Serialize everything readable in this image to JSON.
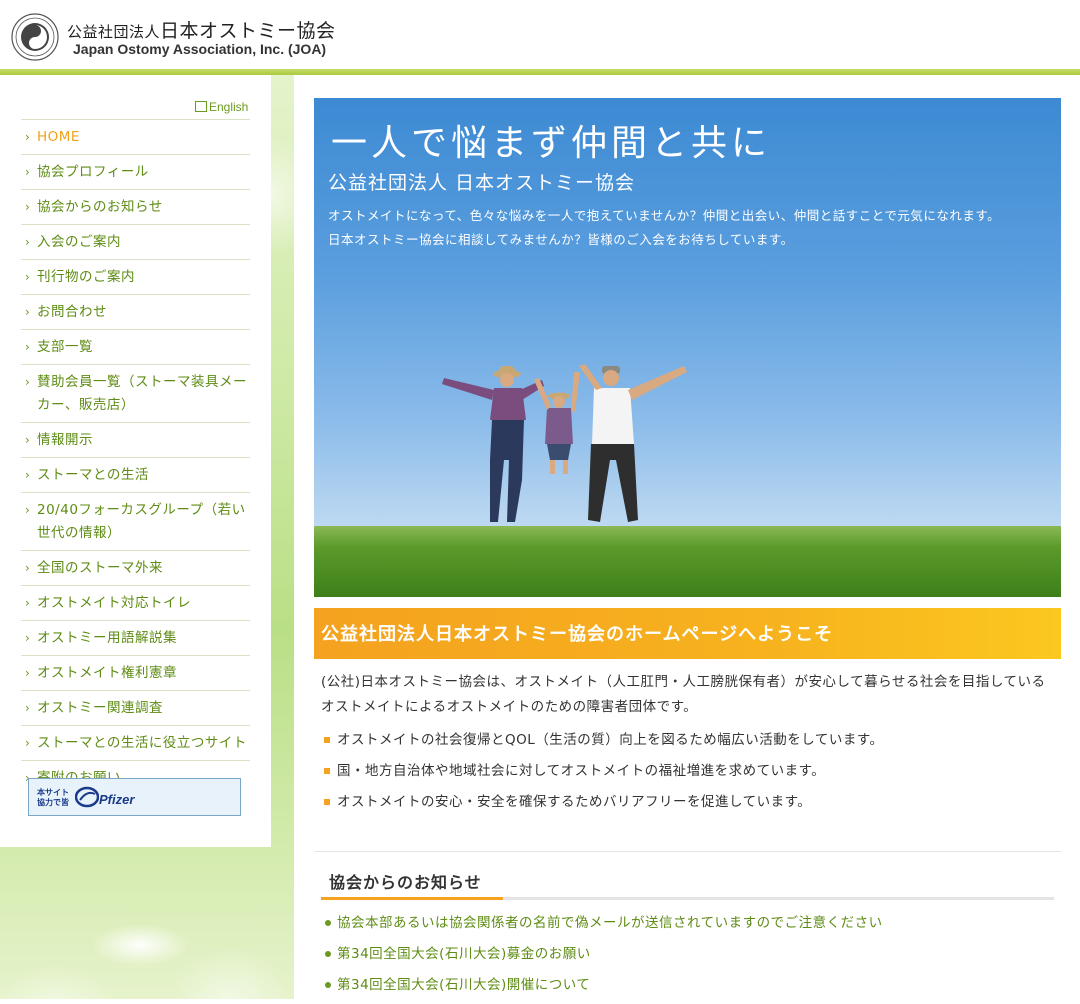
{
  "header": {
    "org_prefix": "公益社団法人",
    "org_name": "日本オストミー協会",
    "org_english": "Japan Ostomy Association, Inc. (JOA)",
    "logo_icon": "joa-seal-icon"
  },
  "sidebar": {
    "english_link": "English",
    "items": [
      {
        "label": "HOME",
        "active": true
      },
      {
        "label": "協会プロフィール"
      },
      {
        "label": "協会からのお知らせ"
      },
      {
        "label": "入会のご案内"
      },
      {
        "label": "刊行物のご案内"
      },
      {
        "label": "お問合わせ"
      },
      {
        "label": "支部一覧"
      },
      {
        "label": "賛助会員一覧（ストーマ装具メーカー、販売店）"
      },
      {
        "label": "情報開示"
      },
      {
        "label": "ストーマとの生活"
      },
      {
        "label": "20/40フォーカスグループ（若い世代の情報）"
      },
      {
        "label": "全国のストーマ外来"
      },
      {
        "label": "オストメイト対応トイレ"
      },
      {
        "label": "オストミー用語解説集"
      },
      {
        "label": "オストメイト権利憲章"
      },
      {
        "label": "オストミー関連調査"
      },
      {
        "label": "ストーマとの生活に役立つサイト"
      },
      {
        "label": "寄附のお願い"
      }
    ],
    "sponsor": {
      "text_line1": "本サイト",
      "text_line2": "協力で皆",
      "name": "Pfizer"
    }
  },
  "hero": {
    "catchphrase": "一人で悩まず仲間と共に",
    "title": "公益社団法人 日本オストミー協会",
    "text_line1": "オストメイトになって、色々な悩みを一人で抱えていませんか？仲間と出会い、仲間と話すことで元気になれます。",
    "text_line2": "日本オストミー協会に相談してみませんか？皆様のご入会をお待ちしています。"
  },
  "welcome": {
    "heading": "公益社団法人日本オストミー協会のホームページへようこそ",
    "intro": "(公社)日本オストミー協会は、オストメイト（人工肛門・人工膀胱保有者）が安心して暮らせる社会を目指しているオストメイトによるオストメイトのための障害者団体です。",
    "goals": [
      "オストメイトの社会復帰とQOL（生活の質）向上を図るため幅広い活動をしています。",
      "国・地方自治体や地域社会に対してオストメイトの福祉増進を求めています。",
      "オストメイトの安心・安全を確保するためバリアフリーを促進しています。"
    ]
  },
  "news": {
    "heading": "協会からのお知らせ",
    "items": [
      "協会本部あるいは協会関係者の名前で偽メールが送信されていますのでご注意ください",
      "第34回全国大会(石川大会)募金のお願い",
      "第34回全国大会(石川大会)開催について"
    ]
  },
  "colors": {
    "accent_green": "#6a9a1f",
    "accent_orange": "#f4a21f",
    "header_line": "#a9c93e"
  }
}
